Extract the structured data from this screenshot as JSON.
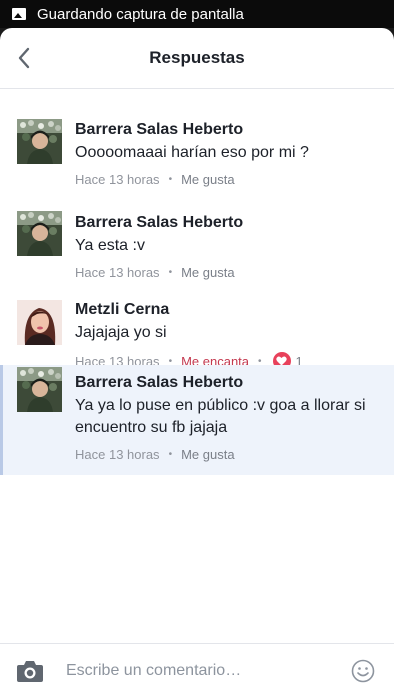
{
  "statusbar": {
    "text": "Guardando captura de pantalla",
    "icon": "image-icon"
  },
  "header": {
    "title": "Respuestas",
    "back_icon": "chevron-left-icon"
  },
  "comments": [
    {
      "author": "Barrera Salas Heberto",
      "text": "Ooooomaaai harían eso por mi ?",
      "time": "Hace 13 horas",
      "action": "Me gusta",
      "highlight": false
    },
    {
      "author": "Barrera Salas Heberto",
      "text": "Ya esta :v",
      "time": "Hace 13 horas",
      "action": "Me gusta",
      "highlight": false
    },
    {
      "author": "Metzli Cerna",
      "text": "Jajajaja yo si",
      "time": "Hace 13 horas",
      "action": "Me encanta",
      "reaction_count": "1",
      "reaction_icon": "heart-icon",
      "highlight": false
    },
    {
      "author": "Barrera Salas Heberto",
      "text": "Ya ya lo puse en público :v goa a llorar si encuentro su fb jajaja",
      "time": "Hace 13 horas",
      "action": "Me gusta",
      "highlight": true
    }
  ],
  "composer": {
    "placeholder": "Escribe un comentario…",
    "camera_icon": "camera-icon",
    "emoji_icon": "smiley-icon"
  },
  "colors": {
    "love_reaction": "#e8415b",
    "highlight_bg": "#eef3fb",
    "meta_text": "#90949c"
  }
}
